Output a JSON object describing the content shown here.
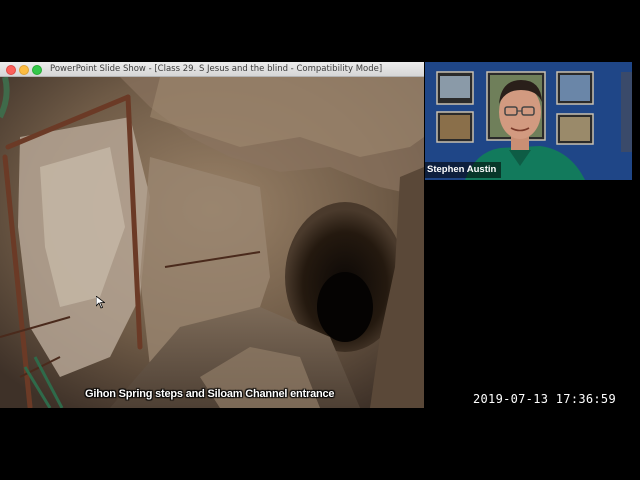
{
  "window": {
    "title": "PowerPoint Slide Show - [Class 29. S Jesus and the blind  -  Compatibility Mode]"
  },
  "slide": {
    "caption": "Gihon Spring steps and Siloam Channel entrance"
  },
  "webcam": {
    "name": "Stephen Austin"
  },
  "recording": {
    "timestamp": "2019-07-13  17:36:59"
  },
  "icons": [
    "close-icon",
    "minimize-icon",
    "maximize-icon",
    "cursor-icon"
  ],
  "colors": {
    "close": "#fc605b",
    "minimize": "#fdbc40",
    "maximize": "#34c84a",
    "webcam_bg": "#1a3f7a"
  }
}
